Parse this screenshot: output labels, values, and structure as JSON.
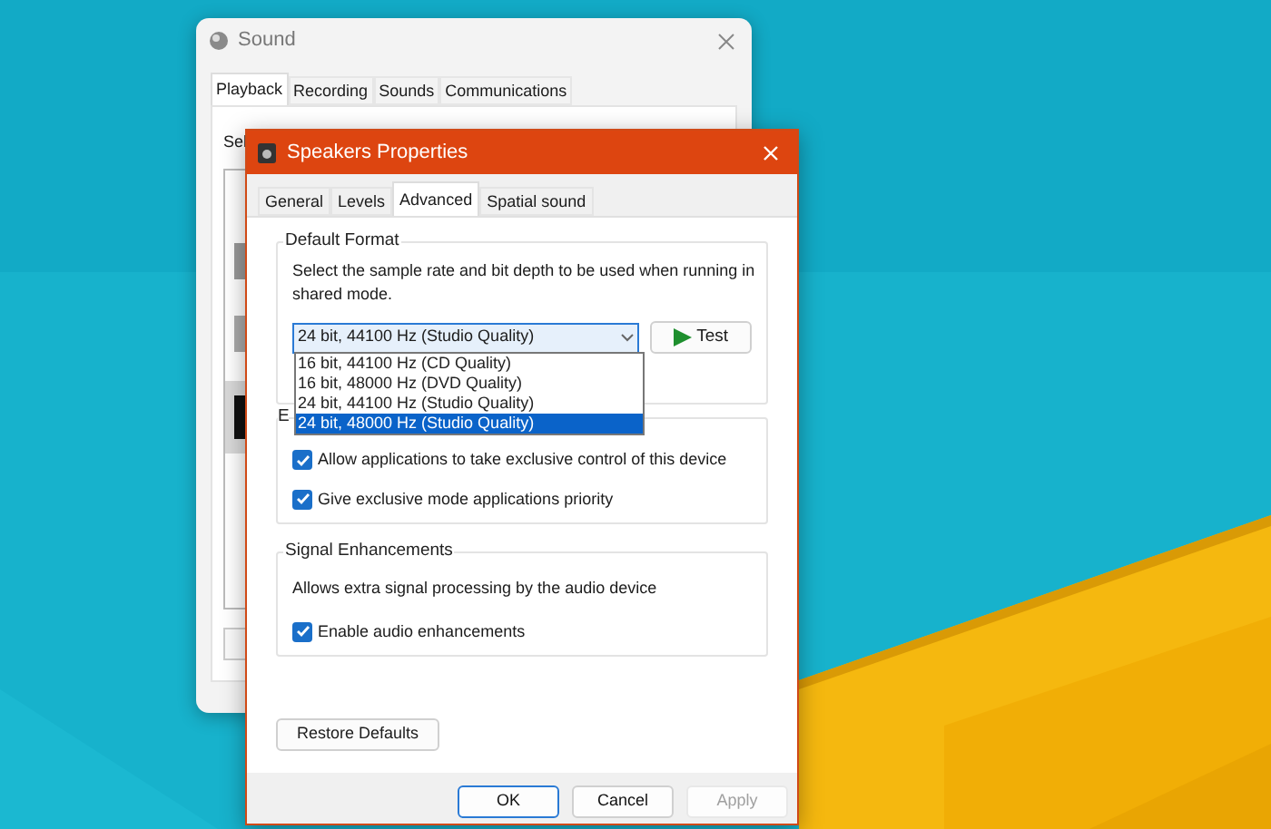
{
  "sound_window": {
    "title": "Sound",
    "tabs": [
      {
        "label": "Playback",
        "selected": true
      },
      {
        "label": "Recording",
        "selected": false
      },
      {
        "label": "Sounds",
        "selected": false
      },
      {
        "label": "Communications",
        "selected": false
      }
    ],
    "instruction": "Sel"
  },
  "dialog": {
    "title": "Speakers Properties",
    "tabs": [
      {
        "label": "General",
        "selected": false
      },
      {
        "label": "Levels",
        "selected": false
      },
      {
        "label": "Advanced",
        "selected": true
      },
      {
        "label": "Spatial sound",
        "selected": false
      }
    ],
    "default_format": {
      "legend": "Default Format",
      "description": "Select the sample rate and bit depth to be used when running in shared mode.",
      "dropdown": {
        "value": "24 bit, 44100 Hz (Studio Quality)",
        "expanded": true,
        "options": [
          {
            "label": "16 bit, 44100 Hz (CD Quality)",
            "highlighted": false
          },
          {
            "label": "16 bit, 48000 Hz (DVD Quality)",
            "highlighted": false
          },
          {
            "label": "24 bit, 44100 Hz (Studio Quality)",
            "highlighted": false
          },
          {
            "label": "24 bit, 48000 Hz (Studio Quality)",
            "highlighted": true
          }
        ]
      },
      "test_button": "Test"
    },
    "exclusive_mode": {
      "legend": "E",
      "options": [
        {
          "label": "Allow applications to take exclusive control of this device",
          "checked": true
        },
        {
          "label": "Give exclusive mode applications priority",
          "checked": true
        }
      ]
    },
    "signal_enhancements": {
      "legend": "Signal Enhancements",
      "description": "Allows extra signal processing by the audio device",
      "options": [
        {
          "label": "Enable audio enhancements",
          "checked": true
        }
      ]
    },
    "restore_button": "Restore Defaults",
    "buttons": [
      {
        "label": "OK",
        "default": true,
        "disabled": false
      },
      {
        "label": "Cancel",
        "default": false,
        "disabled": false
      },
      {
        "label": "Apply",
        "default": false,
        "disabled": true
      }
    ]
  }
}
